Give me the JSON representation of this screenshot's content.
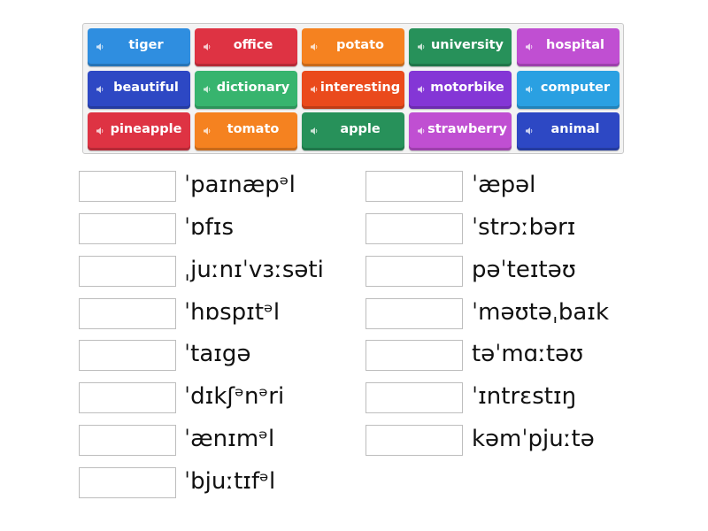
{
  "tiles": [
    {
      "word": "tiger",
      "color": "#2f8ee0"
    },
    {
      "word": "office",
      "color": "#de3343"
    },
    {
      "word": "potato",
      "color": "#f58220"
    },
    {
      "word": "university",
      "color": "#27915a"
    },
    {
      "word": "hospital",
      "color": "#c04fd2"
    },
    {
      "word": "beautiful",
      "color": "#2d48c4"
    },
    {
      "word": "dictionary",
      "color": "#37b46e"
    },
    {
      "word": "interesting",
      "color": "#ea4a1c"
    },
    {
      "word": "motorbike",
      "color": "#8436d6"
    },
    {
      "word": "computer",
      "color": "#2aa0e2"
    },
    {
      "word": "pineapple",
      "color": "#de3343"
    },
    {
      "word": "tomato",
      "color": "#f58220"
    },
    {
      "word": "apple",
      "color": "#27915a"
    },
    {
      "word": "strawberry",
      "color": "#c04fd2"
    },
    {
      "word": "animal",
      "color": "#2d48c4"
    }
  ],
  "speaker_icon": "speaker-icon",
  "targets_left": [
    "ˈpaɪnæpᵊl",
    "ˈɒfɪs",
    "ˌjuːnɪˈvɜːsəti",
    "ˈhɒspɪtᵊl",
    "ˈtaɪgə",
    "ˈdɪkʃᵊnᵊri",
    "ˈænɪmᵊl",
    "ˈbjuːtɪfᵊl"
  ],
  "targets_right": [
    "ˈæpəl",
    "ˈstrɔːbərɪ",
    "pəˈteɪtəʊ",
    "ˈməʊtəˌbaɪk",
    "təˈmɑːtəʊ",
    "ˈɪntrɛstɪŋ",
    "kəmˈpjuːtə"
  ]
}
